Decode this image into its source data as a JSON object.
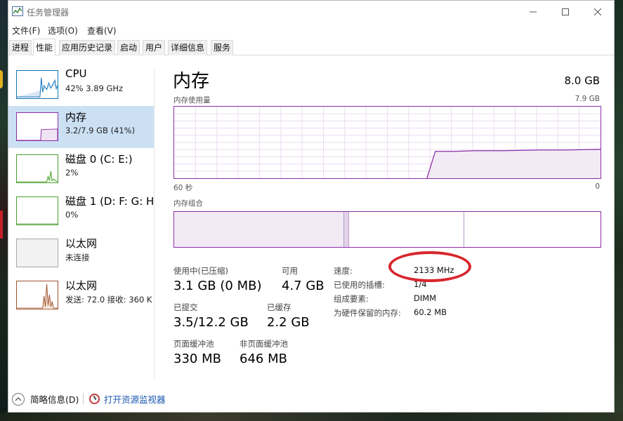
{
  "window": {
    "title": "任务管理器"
  },
  "menu": [
    "文件(F)",
    "选项(O)",
    "查看(V)"
  ],
  "tabs": [
    "进程",
    "性能",
    "应用历史记录",
    "启动",
    "用户",
    "详细信息",
    "服务"
  ],
  "active_tab": "性能",
  "sidebar": [
    {
      "name": "CPU",
      "sub": "42% 3.89 GHz",
      "color": "#1172b8"
    },
    {
      "name": "内存",
      "sub": "3.2/7.9 GB (41%)",
      "color": "#8b2ea6"
    },
    {
      "name": "磁盘 0 (C: E:)",
      "sub": "2%",
      "color": "#4a9e2e"
    },
    {
      "name": "磁盘 1 (D: F: G: H",
      "sub": "0%",
      "color": "#4a9e2e"
    },
    {
      "name": "以太网",
      "sub": "未连接",
      "color": "#a7a7a7"
    },
    {
      "name": "以太网",
      "sub": "发送: 72.0  接收: 360 K",
      "color": "#a0522d"
    }
  ],
  "memory": {
    "title": "内存",
    "capacity": "8.0 GB",
    "usage_label": "内存使用量",
    "usage_max": "7.9 GB",
    "time_left": "60 秒",
    "time_right": "0",
    "composition_label": "内存组合",
    "in_use_label": "使用中(已压缩)",
    "in_use_value": "3.1 GB (0 MB)",
    "available_label": "可用",
    "available_value": "4.7 GB",
    "committed_label": "已提交",
    "committed_value": "3.5/12.2 GB",
    "cached_label": "已缓存",
    "cached_value": "2.2 GB",
    "paged_label": "页面缓冲池",
    "paged_value": "330 MB",
    "nonpaged_label": "非页面缓冲池",
    "nonpaged_value": "646 MB",
    "speed_label": "速度:",
    "speed_value": "2133 MHz",
    "slots_label": "已使用的插槽:",
    "slots_value": "1/4",
    "form_label": "组成要素:",
    "form_value": "DIMM",
    "reserved_label": "为硬件保留的内存:",
    "reserved_value": "60.2 MB"
  },
  "footer": {
    "fewer_details": "简略信息(D)",
    "open_monitor": "打开资源监视器"
  },
  "colors": {
    "memory": "#8b2ea6",
    "highlight": "#d8262d",
    "selected": "#cce0f4",
    "link": "#1857b0"
  }
}
